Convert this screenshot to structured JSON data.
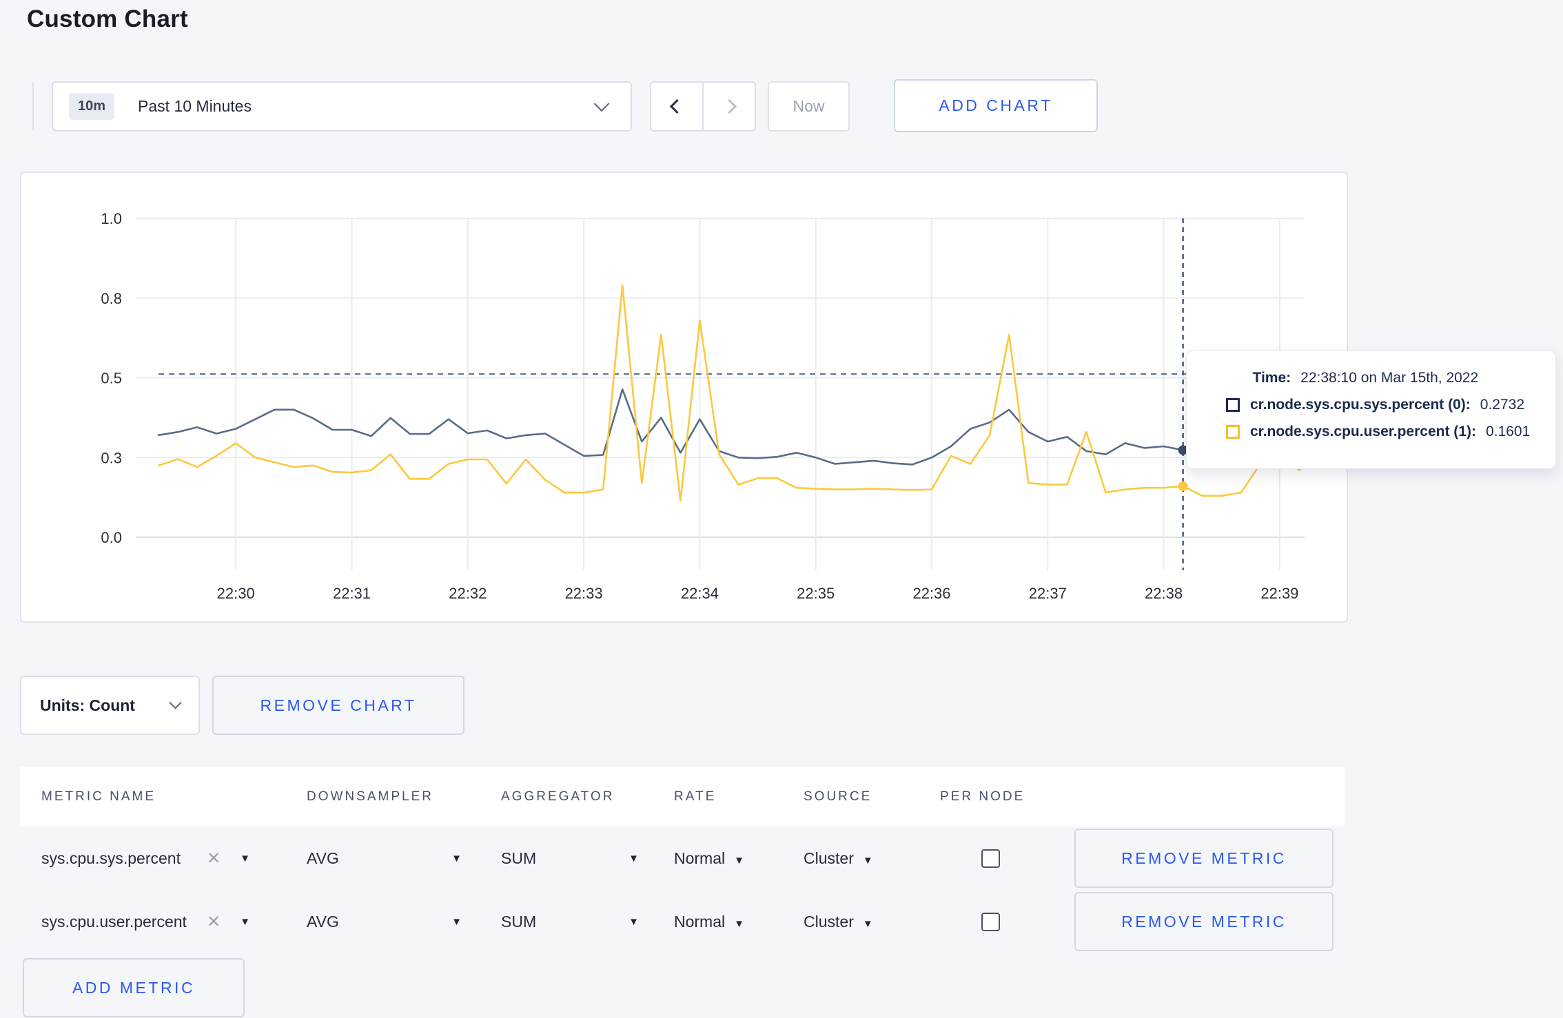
{
  "page": {
    "title": "Custom Chart",
    "background": "#f4f6f9",
    "accent_blue": "#2b58ef"
  },
  "toolbar": {
    "time_range": {
      "badge": "10m",
      "label": "Past 10 Minutes"
    },
    "now_label": "Now",
    "add_chart_label": "ADD CHART"
  },
  "icons": {
    "clear": "✕",
    "caret_down": "▼"
  },
  "chart_data": {
    "type": "line",
    "title": "",
    "xlabel": "",
    "ylabel": "",
    "ylim": [
      0,
      1
    ],
    "grid": true,
    "x_start_time": "22:29:20",
    "x_interval_seconds": 10,
    "x_ticks": [
      {
        "label": "22:30",
        "t": 40
      },
      {
        "label": "22:31",
        "t": 100
      },
      {
        "label": "22:32",
        "t": 160
      },
      {
        "label": "22:33",
        "t": 220
      },
      {
        "label": "22:34",
        "t": 280
      },
      {
        "label": "22:35",
        "t": 340
      },
      {
        "label": "22:36",
        "t": 400
      },
      {
        "label": "22:37",
        "t": 460
      },
      {
        "label": "22:38",
        "t": 520
      },
      {
        "label": "22:39",
        "t": 580
      }
    ],
    "y_ticks": [
      {
        "label": "0.0",
        "value": 0
      },
      {
        "label": "0.3",
        "value": 0.25
      },
      {
        "label": "0.5",
        "value": 0.5
      },
      {
        "label": "0.8",
        "value": 0.75
      },
      {
        "label": "1.0",
        "value": 1.0
      }
    ],
    "reference_dashed_line_value": 0.512,
    "crosshair": {
      "t": 530,
      "time": "22:38:10"
    },
    "series": [
      {
        "name": "cr.node.sys.cpu.sys.percent",
        "color": "#5a6b87",
        "hover_value": 0.2732,
        "values": [
          0.32,
          0.33,
          0.345,
          0.325,
          0.34,
          0.37,
          0.4,
          0.4,
          0.373,
          0.337,
          0.337,
          0.317,
          0.374,
          0.324,
          0.324,
          0.37,
          0.326,
          0.335,
          0.31,
          0.32,
          0.325,
          0.29,
          0.255,
          0.258,
          0.464,
          0.3,
          0.375,
          0.265,
          0.37,
          0.27,
          0.25,
          0.248,
          0.252,
          0.265,
          0.25,
          0.23,
          0.235,
          0.24,
          0.232,
          0.228,
          0.25,
          0.285,
          0.34,
          0.36,
          0.4,
          0.33,
          0.3,
          0.315,
          0.27,
          0.26,
          0.295,
          0.28,
          0.285,
          0.2732,
          0.265,
          0.27,
          0.28,
          0.3,
          0.29,
          0.3,
          0.285
        ]
      },
      {
        "name": "cr.node.sys.cpu.user.percent",
        "color": "#fcc83d",
        "hover_value": 0.1601,
        "values": [
          0.225,
          0.245,
          0.22,
          0.255,
          0.295,
          0.25,
          0.235,
          0.22,
          0.225,
          0.205,
          0.203,
          0.21,
          0.26,
          0.183,
          0.183,
          0.23,
          0.244,
          0.244,
          0.168,
          0.244,
          0.18,
          0.14,
          0.14,
          0.15,
          0.79,
          0.17,
          0.635,
          0.115,
          0.68,
          0.26,
          0.165,
          0.185,
          0.185,
          0.155,
          0.152,
          0.15,
          0.15,
          0.152,
          0.15,
          0.148,
          0.15,
          0.255,
          0.23,
          0.32,
          0.635,
          0.17,
          0.165,
          0.165,
          0.33,
          0.14,
          0.15,
          0.155,
          0.155,
          0.1601,
          0.13,
          0.13,
          0.14,
          0.23,
          0.28,
          0.21,
          0.26
        ]
      }
    ],
    "tooltip": {
      "time_label": "Time:",
      "time_value": "22:38:10 on Mar 15th, 2022",
      "entries": [
        {
          "name": "cr.node.sys.cpu.sys.percent (0):",
          "value": "0.2732",
          "swatch_color": "#1e2b50"
        },
        {
          "name": "cr.node.sys.cpu.user.percent (1):",
          "value": "0.1601",
          "swatch_color": "#f5c02c"
        }
      ]
    }
  },
  "units_bar": {
    "units_label": "Units: Count",
    "remove_chart_label": "REMOVE CHART"
  },
  "metrics_table": {
    "headers": [
      "METRIC NAME",
      "DOWNSAMPLER",
      "AGGREGATOR",
      "RATE",
      "SOURCE",
      "PER NODE"
    ],
    "rows": [
      {
        "metric_name": "sys.cpu.sys.percent",
        "downsampler": "AVG",
        "aggregator": "SUM",
        "rate": "Normal",
        "source": "Cluster",
        "per_node_checked": false,
        "remove_label": "REMOVE METRIC"
      },
      {
        "metric_name": "sys.cpu.user.percent",
        "downsampler": "AVG",
        "aggregator": "SUM",
        "rate": "Normal",
        "source": "Cluster",
        "per_node_checked": false,
        "remove_label": "REMOVE METRIC"
      }
    ],
    "add_metric_label": "ADD METRIC"
  }
}
